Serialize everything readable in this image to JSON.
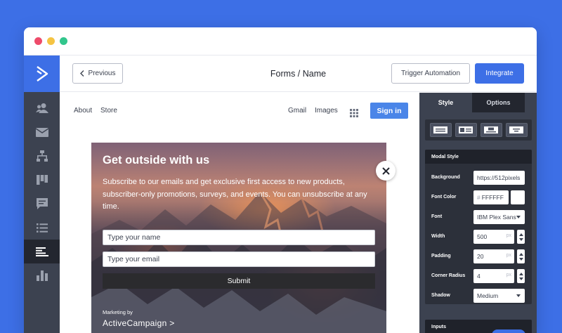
{
  "colors": {
    "background": "#3d6fe6",
    "window_dot_red": "#ee4b6a",
    "window_dot_yellow": "#f5c443",
    "window_dot_green": "#32c68c",
    "accent": "#3d6fe6",
    "sidebar": "#3c4250",
    "sidebar_active": "#23262f",
    "google_signin": "#4a85e8"
  },
  "left_nav": {
    "logo_icon": "activecampaign-chevron-icon",
    "items": [
      {
        "icon": "contacts-icon",
        "active": false
      },
      {
        "icon": "mail-icon",
        "active": false
      },
      {
        "icon": "automation-icon",
        "active": false
      },
      {
        "icon": "deals-icon",
        "active": false
      },
      {
        "icon": "conversations-icon",
        "active": false
      },
      {
        "icon": "lists-icon",
        "active": false
      },
      {
        "icon": "forms-icon",
        "active": true
      },
      {
        "icon": "reports-icon",
        "active": false
      }
    ]
  },
  "topbar": {
    "previous_label": "Previous",
    "breadcrumb_parent": "Forms",
    "breadcrumb_separator": " / ",
    "breadcrumb_current": "Name",
    "trigger_label": "Trigger Automation",
    "integrate_label": "Integrate"
  },
  "preview": {
    "nav_left": [
      "About",
      "Store"
    ],
    "nav_right": [
      "Gmail",
      "Images"
    ],
    "signin_label": "Sign in",
    "modal": {
      "title": "Get outside with us",
      "body": "Subscribe to our emails and get exclusive first access to new products, subscriber-only promotions, surveys, and events. You can unsubscribe at any time.",
      "name_placeholder": "Type your name",
      "email_placeholder": "Type your email",
      "submit_label": "Submit",
      "marketing_by": "Marketing by",
      "brand": "ActiveCampaign >"
    }
  },
  "panel": {
    "tabs": [
      "Style",
      "Options"
    ],
    "active_tab": "Style",
    "layout_options": [
      "layout-full-icon",
      "layout-image-left-icon",
      "layout-image-top-icon",
      "layout-centered-icon"
    ],
    "modal_style": {
      "heading": "Modal Style",
      "background_label": "Background",
      "background_value": "https://512pixels",
      "font_color_label": "Font Color",
      "font_color_hash": "#",
      "font_color_value": "FFFFFF",
      "font_label": "Font",
      "font_value": "IBM Plex Sans",
      "width_label": "Width",
      "width_value": "500",
      "width_unit": "px",
      "padding_label": "Padding",
      "padding_value": "20",
      "padding_unit": "px",
      "corner_radius_label": "Corner Radius",
      "corner_radius_value": "4",
      "corner_radius_unit": "px",
      "shadow_label": "Shadow",
      "shadow_value": "Medium"
    },
    "inputs_heading": "Inputs"
  }
}
